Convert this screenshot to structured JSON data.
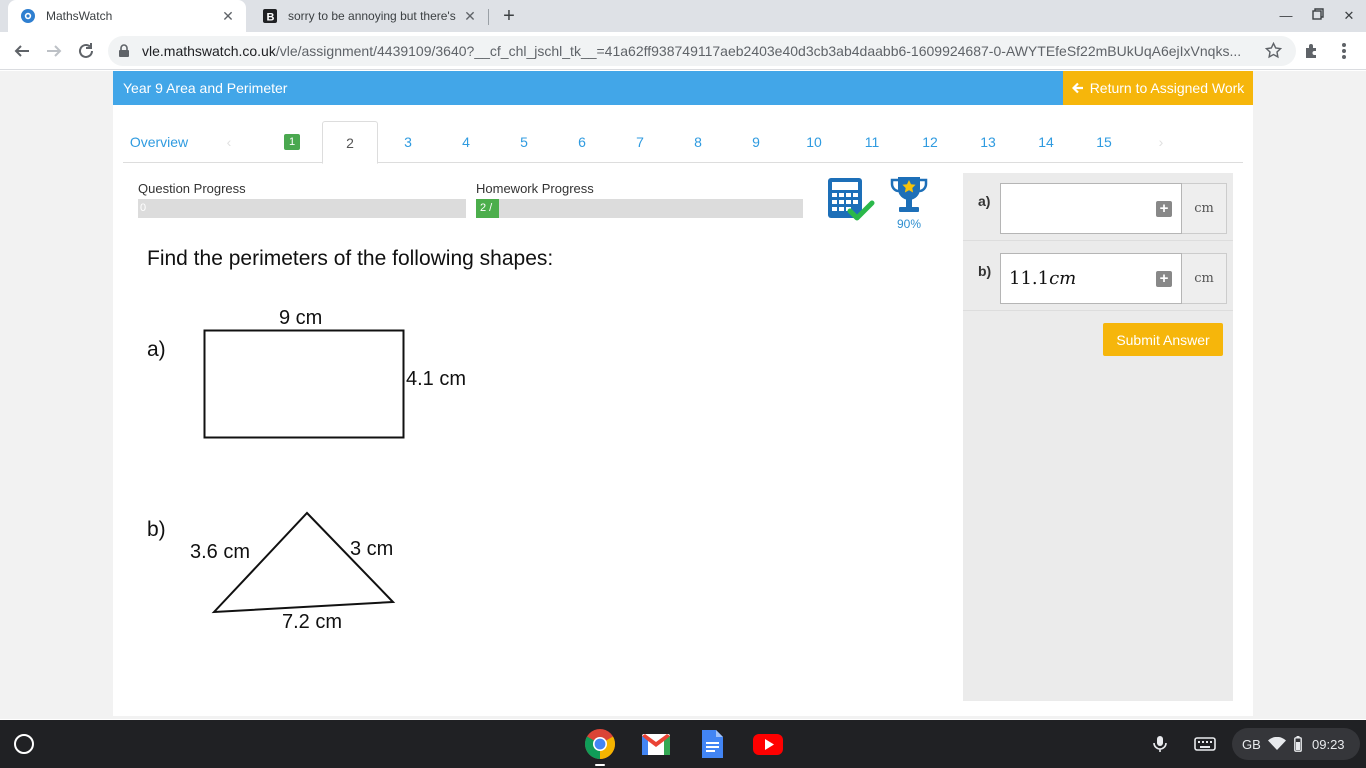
{
  "browser": {
    "tabs": [
      {
        "title": "MathsWatch",
        "active": true
      },
      {
        "title": "sorry to be annoying but there's",
        "active": false
      }
    ],
    "new_tab_symbol": "+",
    "url_host": "vle.mathswatch.co.uk",
    "url_path": "/vle/assignment/4439109/3640?__cf_chl_jschl_tk__=41a62ff938749117aeb2403e40d3cb3ab4daabb6-1609924687-0-AWYTEfeSf22mBUkUqA6ejIxVnqks..."
  },
  "header": {
    "title": "Year 9 Area and Perimeter",
    "return_label": "Return to Assigned Work"
  },
  "question_nav": {
    "overview": "Overview",
    "items": [
      "1",
      "2",
      "3",
      "4",
      "5",
      "6",
      "7",
      "8",
      "9",
      "10",
      "11",
      "12",
      "13",
      "14",
      "15"
    ],
    "completed": [
      "1"
    ],
    "active": "2"
  },
  "progress": {
    "question_label": "Question Progress",
    "question_value": "0",
    "question_fraction": 0,
    "homework_label": "Homework Progress",
    "homework_value": "2 /",
    "homework_fraction": 0.07
  },
  "trophy_percent": "90%",
  "question": {
    "text": "Find the perimeters of the following shapes:",
    "part_a": {
      "label": "a)",
      "width_label": "9 cm",
      "height_label": "4.1 cm"
    },
    "part_b": {
      "label": "b)",
      "left_label": "3.6 cm",
      "right_label": "3 cm",
      "base_label": "7.2 cm"
    }
  },
  "answers": {
    "a": {
      "label": "a)",
      "value": "",
      "unit": "cm"
    },
    "b": {
      "label": "b)",
      "value": "11.1",
      "value_unit": "cm",
      "unit": "cm"
    },
    "submit_label": "Submit Answer"
  },
  "shelf": {
    "keyboard_layout": "GB",
    "time": "09:23"
  },
  "colors": {
    "header_blue": "#42a6e8",
    "accent_yellow": "#f6b60b",
    "done_green": "#4aa84f"
  }
}
